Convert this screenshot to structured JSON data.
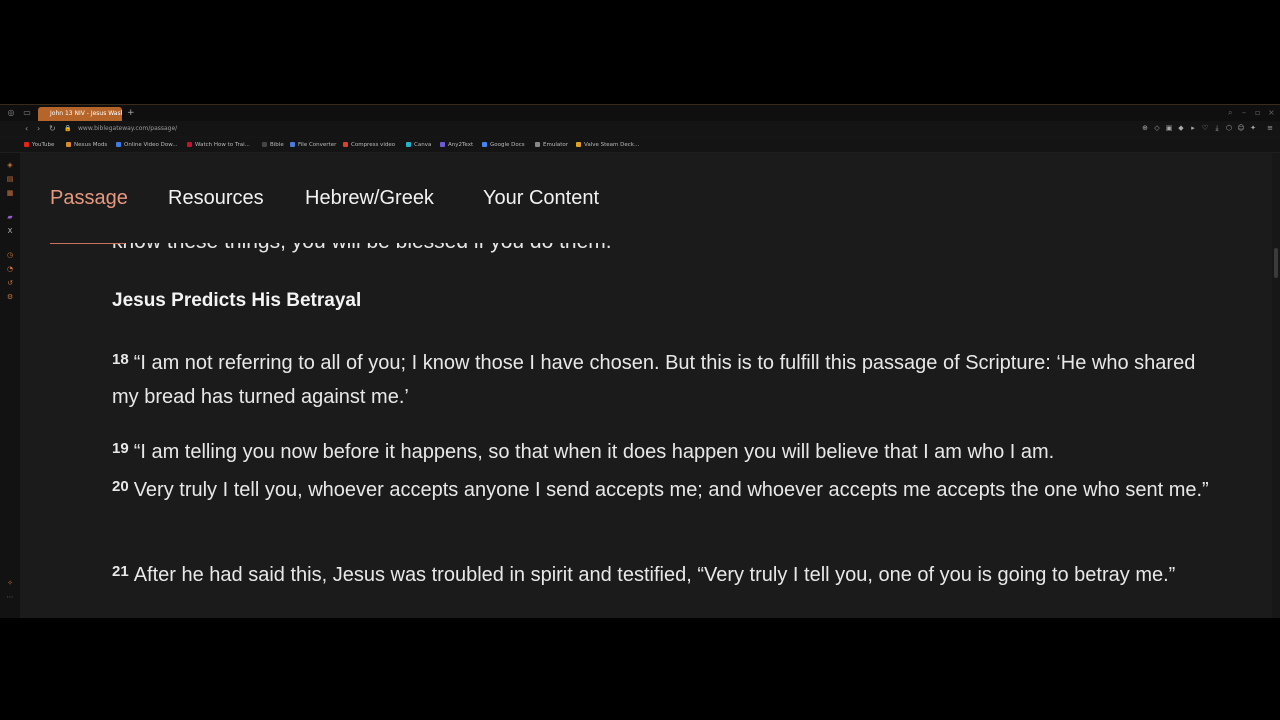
{
  "browser": {
    "active_tab": "John 13 NIV - Jesus Wash",
    "new_tab_symbol": "+",
    "url": "www.biblegateway.com/passage/",
    "bookmarks": [
      {
        "label": "YouTube",
        "color": "#e62117"
      },
      {
        "label": "Nexus Mods",
        "color": "#d98a2b"
      },
      {
        "label": "Online Video Dow...",
        "color": "#3b7de0"
      },
      {
        "label": "Watch How to Trai...",
        "color": "#c8102e"
      },
      {
        "label": "Bible",
        "color": "#444444"
      },
      {
        "label": "File Converter",
        "color": "#4a7bd6"
      },
      {
        "label": "Compress video",
        "color": "#d8402c"
      },
      {
        "label": "Canva",
        "color": "#20b3c9"
      },
      {
        "label": "Any2Text",
        "color": "#6b5bd6"
      },
      {
        "label": "Google Docs",
        "color": "#4285f4"
      },
      {
        "label": "Emulator",
        "color": "#888888"
      },
      {
        "label": "Valve Steam Deck...",
        "color": "#e0a020"
      }
    ],
    "accent_color": "#b5652a"
  },
  "nav": {
    "tabs": [
      "Passage",
      "Resources",
      "Hebrew/Greek",
      "Your Content"
    ],
    "active_color": "#e59a80"
  },
  "passage": {
    "cutoff_text": "know these things, you will be blessed if you do them.",
    "heading": "Jesus Predicts His Betrayal",
    "paragraphs": [
      {
        "verses": [
          {
            "num": "18",
            "text": "“I am not referring to all of you; I know those I have chosen. But this is to fulfill this passage of Scripture: ‘He who shared my bread has turned against me.’"
          }
        ]
      },
      {
        "verses": [
          {
            "num": "19",
            "text": "“I am telling you now before it happens, so that when it does happen you will believe that I am who I am."
          },
          {
            "num": "20",
            "text": "Very truly I tell you, whoever accepts anyone I send accepts me; and whoever accepts me accepts the one who sent me.”"
          }
        ]
      },
      {
        "verses": [
          {
            "num": "21",
            "text": "After he had said this, Jesus was troubled in spirit and testified, “Very truly I tell you, one of you is going to betray me.”"
          }
        ]
      }
    ]
  }
}
